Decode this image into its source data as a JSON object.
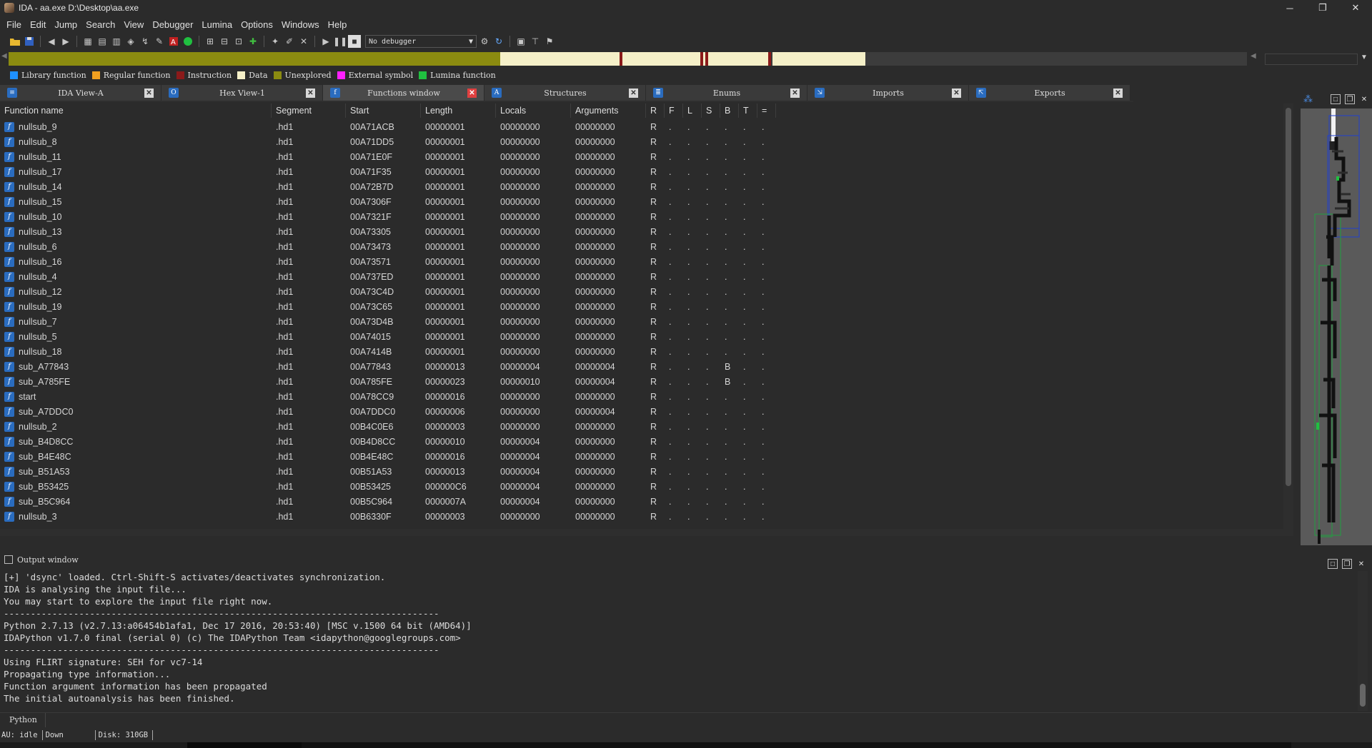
{
  "window": {
    "title": "IDA - aa.exe D:\\Desktop\\aa.exe",
    "minimize": "─",
    "maximize": "❐",
    "close": "✕"
  },
  "menu": [
    "File",
    "Edit",
    "Jump",
    "Search",
    "View",
    "Debugger",
    "Lumina",
    "Options",
    "Windows",
    "Help"
  ],
  "toolbar": {
    "debugger_select": "No debugger"
  },
  "legend": [
    {
      "label": "Library function",
      "color": "#1e90ff"
    },
    {
      "label": "Regular function",
      "color": "#f0a020"
    },
    {
      "label": "Instruction",
      "color": "#8b1a1a"
    },
    {
      "label": "Data",
      "color": "#f5f0c8"
    },
    {
      "label": "Unexplored",
      "color": "#8b8b10"
    },
    {
      "label": "External symbol",
      "color": "#ff20ff"
    },
    {
      "label": "Lumina function",
      "color": "#20c040"
    }
  ],
  "tabs": [
    {
      "label": "IDA View-A",
      "icon": "disassembly-icon",
      "glyph": "≡",
      "active": false
    },
    {
      "label": "Hex View-1",
      "icon": "hex-icon",
      "glyph": "O",
      "active": false
    },
    {
      "label": "Functions window",
      "icon": "function-icon",
      "glyph": "f",
      "active": true
    },
    {
      "label": "Structures",
      "icon": "structures-icon",
      "glyph": "A",
      "active": false
    },
    {
      "label": "Enums",
      "icon": "enums-icon",
      "glyph": "≣",
      "active": false
    },
    {
      "label": "Imports",
      "icon": "imports-icon",
      "glyph": "⇲",
      "active": false
    },
    {
      "label": "Exports",
      "icon": "exports-icon",
      "glyph": "⇱",
      "active": false
    }
  ],
  "functions": {
    "columns": [
      "Function name",
      "Segment",
      "Start",
      "Length",
      "Locals",
      "Arguments",
      "R",
      "F",
      "L",
      "S",
      "B",
      "T",
      "="
    ],
    "rows": [
      [
        "nullsub_9",
        ".hd1",
        "00A71ACB",
        "00000001",
        "00000000",
        "00000000",
        "R",
        ".",
        ".",
        ".",
        ".",
        ".",
        "."
      ],
      [
        "nullsub_8",
        ".hd1",
        "00A71DD5",
        "00000001",
        "00000000",
        "00000000",
        "R",
        ".",
        ".",
        ".",
        ".",
        ".",
        "."
      ],
      [
        "nullsub_11",
        ".hd1",
        "00A71E0F",
        "00000001",
        "00000000",
        "00000000",
        "R",
        ".",
        ".",
        ".",
        ".",
        ".",
        "."
      ],
      [
        "nullsub_17",
        ".hd1",
        "00A71F35",
        "00000001",
        "00000000",
        "00000000",
        "R",
        ".",
        ".",
        ".",
        ".",
        ".",
        "."
      ],
      [
        "nullsub_14",
        ".hd1",
        "00A72B7D",
        "00000001",
        "00000000",
        "00000000",
        "R",
        ".",
        ".",
        ".",
        ".",
        ".",
        "."
      ],
      [
        "nullsub_15",
        ".hd1",
        "00A7306F",
        "00000001",
        "00000000",
        "00000000",
        "R",
        ".",
        ".",
        ".",
        ".",
        ".",
        "."
      ],
      [
        "nullsub_10",
        ".hd1",
        "00A7321F",
        "00000001",
        "00000000",
        "00000000",
        "R",
        ".",
        ".",
        ".",
        ".",
        ".",
        "."
      ],
      [
        "nullsub_13",
        ".hd1",
        "00A73305",
        "00000001",
        "00000000",
        "00000000",
        "R",
        ".",
        ".",
        ".",
        ".",
        ".",
        "."
      ],
      [
        "nullsub_6",
        ".hd1",
        "00A73473",
        "00000001",
        "00000000",
        "00000000",
        "R",
        ".",
        ".",
        ".",
        ".",
        ".",
        "."
      ],
      [
        "nullsub_16",
        ".hd1",
        "00A73571",
        "00000001",
        "00000000",
        "00000000",
        "R",
        ".",
        ".",
        ".",
        ".",
        ".",
        "."
      ],
      [
        "nullsub_4",
        ".hd1",
        "00A737ED",
        "00000001",
        "00000000",
        "00000000",
        "R",
        ".",
        ".",
        ".",
        ".",
        ".",
        "."
      ],
      [
        "nullsub_12",
        ".hd1",
        "00A73C4D",
        "00000001",
        "00000000",
        "00000000",
        "R",
        ".",
        ".",
        ".",
        ".",
        ".",
        "."
      ],
      [
        "nullsub_19",
        ".hd1",
        "00A73C65",
        "00000001",
        "00000000",
        "00000000",
        "R",
        ".",
        ".",
        ".",
        ".",
        ".",
        "."
      ],
      [
        "nullsub_7",
        ".hd1",
        "00A73D4B",
        "00000001",
        "00000000",
        "00000000",
        "R",
        ".",
        ".",
        ".",
        ".",
        ".",
        "."
      ],
      [
        "nullsub_5",
        ".hd1",
        "00A74015",
        "00000001",
        "00000000",
        "00000000",
        "R",
        ".",
        ".",
        ".",
        ".",
        ".",
        "."
      ],
      [
        "nullsub_18",
        ".hd1",
        "00A7414B",
        "00000001",
        "00000000",
        "00000000",
        "R",
        ".",
        ".",
        ".",
        ".",
        ".",
        "."
      ],
      [
        "sub_A77843",
        ".hd1",
        "00A77843",
        "00000013",
        "00000004",
        "00000004",
        "R",
        ".",
        ".",
        ".",
        "B",
        ".",
        "."
      ],
      [
        "sub_A785FE",
        ".hd1",
        "00A785FE",
        "00000023",
        "00000010",
        "00000004",
        "R",
        ".",
        ".",
        ".",
        "B",
        ".",
        "."
      ],
      [
        "start",
        ".hd1",
        "00A78CC9",
        "00000016",
        "00000000",
        "00000000",
        "R",
        ".",
        ".",
        ".",
        ".",
        ".",
        "."
      ],
      [
        "sub_A7DDC0",
        ".hd1",
        "00A7DDC0",
        "00000006",
        "00000000",
        "00000004",
        "R",
        ".",
        ".",
        ".",
        ".",
        ".",
        "."
      ],
      [
        "nullsub_2",
        ".hd1",
        "00B4C0E6",
        "00000003",
        "00000000",
        "00000000",
        "R",
        ".",
        ".",
        ".",
        ".",
        ".",
        "."
      ],
      [
        "sub_B4D8CC",
        ".hd1",
        "00B4D8CC",
        "00000010",
        "00000004",
        "00000000",
        "R",
        ".",
        ".",
        ".",
        ".",
        ".",
        "."
      ],
      [
        "sub_B4E48C",
        ".hd1",
        "00B4E48C",
        "00000016",
        "00000004",
        "00000000",
        "R",
        ".",
        ".",
        ".",
        ".",
        ".",
        "."
      ],
      [
        "sub_B51A53",
        ".hd1",
        "00B51A53",
        "00000013",
        "00000004",
        "00000000",
        "R",
        ".",
        ".",
        ".",
        ".",
        ".",
        "."
      ],
      [
        "sub_B53425",
        ".hd1",
        "00B53425",
        "000000C6",
        "00000004",
        "00000000",
        "R",
        ".",
        ".",
        ".",
        ".",
        ".",
        "."
      ],
      [
        "sub_B5C964",
        ".hd1",
        "00B5C964",
        "0000007A",
        "00000004",
        "00000000",
        "R",
        ".",
        ".",
        ".",
        ".",
        ".",
        "."
      ],
      [
        "nullsub_3",
        ".hd1",
        "00B6330F",
        "00000003",
        "00000000",
        "00000000",
        "R",
        ".",
        ".",
        ".",
        ".",
        ".",
        "."
      ]
    ]
  },
  "output": {
    "title": "Output window",
    "lines": [
      "[+] 'dsync' loaded. Ctrl-Shift-S activates/deactivates synchronization.",
      "IDA is analysing the input file...",
      "You may start to explore the input file right now.",
      "---------------------------------------------------------------------------------",
      "Python 2.7.13 (v2.7.13:a06454b1afa1, Dec 17 2016, 20:53:40) [MSC v.1500 64 bit (AMD64)]",
      "IDAPython v1.7.0 final (serial 0) (c) The IDAPython Team <idapython@googlegroups.com>",
      "---------------------------------------------------------------------------------",
      "Using FLIRT signature: SEH for vc7-14",
      "Propagating type information...",
      "Function argument information has been propagated",
      "The initial autoanalysis has been finished."
    ]
  },
  "python_label": "Python",
  "status": {
    "au": "AU:  idle",
    "direction": "Down",
    "disk": "Disk: 310GB"
  }
}
